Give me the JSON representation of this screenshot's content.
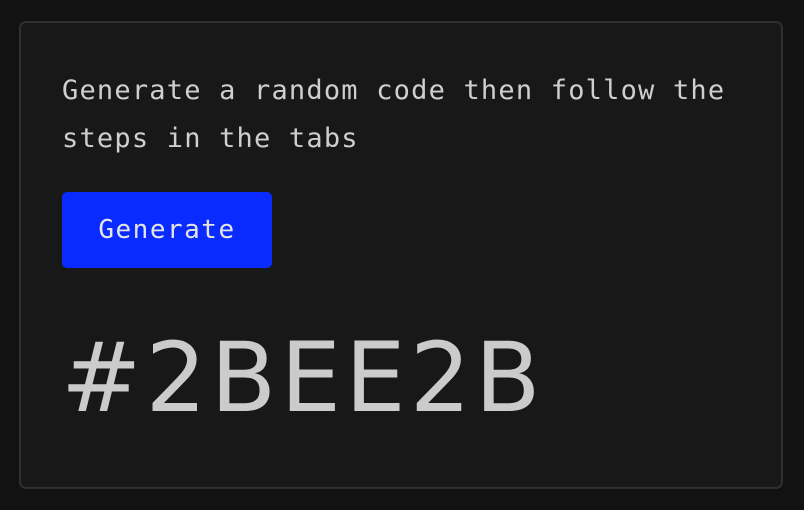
{
  "card": {
    "description": "Generate a random code then follow the steps in the tabs",
    "generate_button_label": "Generate",
    "code_value": "#2BEE2B"
  },
  "colors": {
    "page_background": "#121212",
    "card_background": "#181818",
    "card_border": "#2f2f2f",
    "accent_button": "#0a2bff",
    "text": "#cfcfcf"
  }
}
